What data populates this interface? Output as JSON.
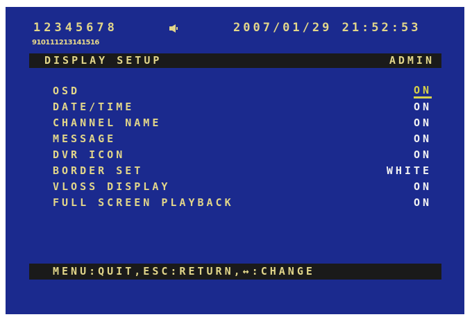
{
  "status": {
    "channels_top": "12345678",
    "speaker_icon": "speaker-icon",
    "datetime": "2007/01/29 21:52:53",
    "channels_sub": "910111213141516"
  },
  "header": {
    "title": "DISPLAY SETUP",
    "user": "ADMIN"
  },
  "menu": {
    "items": [
      {
        "label": "OSD",
        "value": "ON"
      },
      {
        "label": "DATE/TIME",
        "value": "ON"
      },
      {
        "label": "CHANNEL NAME",
        "value": "ON"
      },
      {
        "label": "MESSAGE",
        "value": "ON"
      },
      {
        "label": "DVR ICON",
        "value": "ON"
      },
      {
        "label": "BORDER SET",
        "value": "WHITE"
      },
      {
        "label": "VLOSS DISPLAY",
        "value": "ON"
      },
      {
        "label": "FULL SCREEN PLAYBACK",
        "value": "ON"
      }
    ],
    "selected_index": 0
  },
  "footer": {
    "help_text": "MENU:QUIT,ESC:RETURN,↔:CHANGE"
  },
  "colors": {
    "background": "#1b2a8e",
    "text": "#e2d68a",
    "value": "#f2f2f2",
    "highlight": "#d8d24a",
    "bar": "#1a1a1a"
  }
}
